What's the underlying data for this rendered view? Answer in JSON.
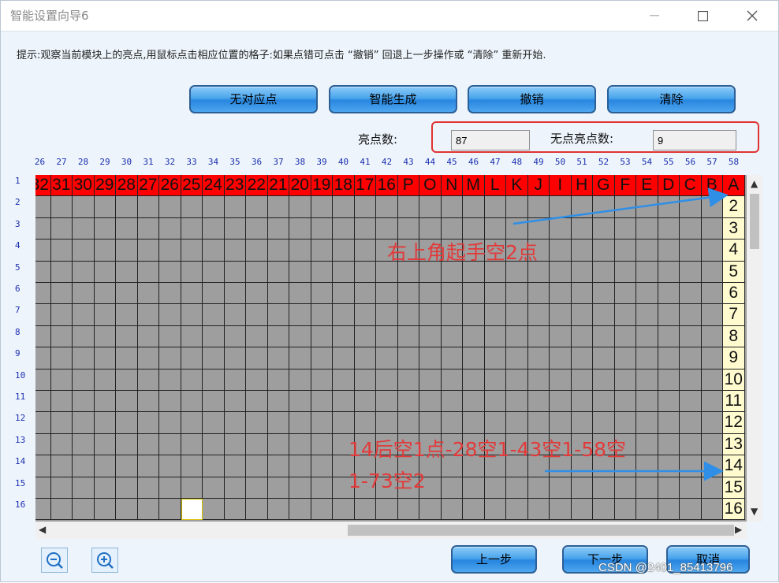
{
  "window": {
    "title": "智能设置向导6",
    "min_icon": "minimize-icon",
    "max_icon": "maximize-icon",
    "close_icon": "close-icon"
  },
  "tip": "提示:观察当前模块上的亮点,用鼠标点击相应位置的格子:如果点错可点击 “撤销” 回退上一步操作或 “清除” 重新开始.",
  "toolbar": {
    "no_match": "无对应点",
    "smart_generate": "智能生成",
    "undo": "撤销",
    "clear": "清除"
  },
  "counts": {
    "lit_label": "亮点数:",
    "lit_value": "87",
    "unlit_label": "无点亮点数:",
    "unlit_value": "9"
  },
  "grid": {
    "col_headers": [
      "26",
      "27",
      "28",
      "29",
      "30",
      "31",
      "32",
      "33",
      "34",
      "35",
      "36",
      "37",
      "38",
      "39",
      "40",
      "41",
      "42",
      "43",
      "44",
      "45",
      "46",
      "47",
      "48",
      "49",
      "50",
      "51",
      "52",
      "53",
      "54",
      "55",
      "56",
      "57",
      "58"
    ],
    "row_headers": [
      "1",
      "2",
      "3",
      "4",
      "5",
      "6",
      "7",
      "8",
      "9",
      "10",
      "11",
      "12",
      "13",
      "14",
      "15",
      "16"
    ],
    "top_row_labels": [
      "32",
      "31",
      "30",
      "29",
      "28",
      "27",
      "26",
      "25",
      "24",
      "23",
      "22",
      "21",
      "20",
      "19",
      "18",
      "17",
      "16",
      "P",
      "O",
      "N",
      "M",
      "L",
      "K",
      "J",
      "I",
      "H",
      "G",
      "F",
      "E",
      "D",
      "C",
      "B",
      "A"
    ],
    "right_col_labels": [
      "A",
      "2",
      "3",
      "4",
      "5",
      "6",
      "7",
      "8",
      "9",
      "10",
      "11",
      "12",
      "13",
      "14",
      "15",
      "16"
    ],
    "white_cell": {
      "row": 16,
      "col": "33"
    }
  },
  "annotations": {
    "note1": "右上角起手空2点",
    "note2_line1": "14后空1点-28空1-43空1-58空",
    "note2_line2": "1-73空2"
  },
  "footer": {
    "prev": "上一步",
    "next": "下一步",
    "cancel": "取消",
    "zoom_out_icon": "zoom-out-icon",
    "zoom_in_icon": "zoom-in-icon"
  },
  "watermark": "CSDN @2401_85413796",
  "colors": {
    "lit_red": "#ff0000",
    "cream": "#fffbcf",
    "annotation_red": "#e23a3a",
    "arrow_blue": "#2f8fe6",
    "button_blue": "#2886e0"
  }
}
